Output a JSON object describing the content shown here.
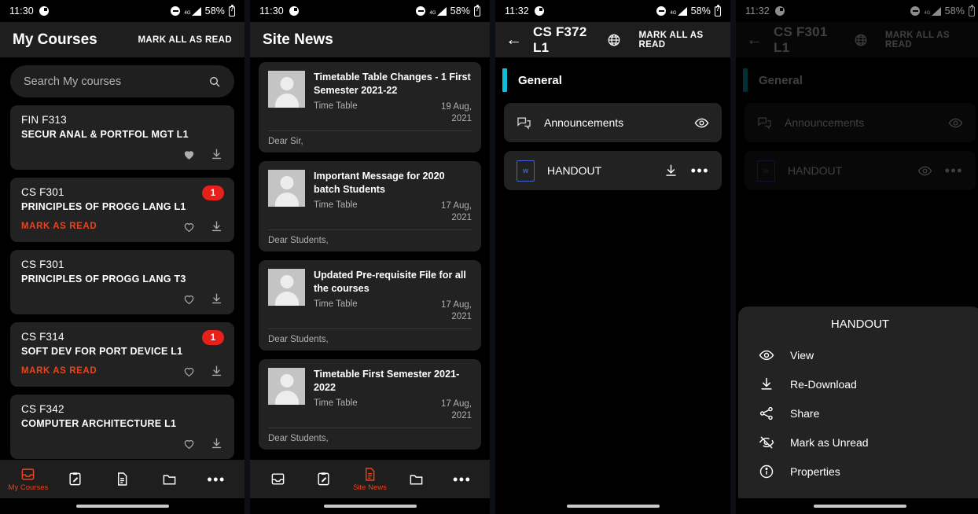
{
  "panels": [
    {
      "status": {
        "time": "11:30",
        "battery": "58%",
        "network": "4G"
      },
      "appbar": {
        "title": "My Courses",
        "action": "MARK ALL AS READ"
      },
      "search": {
        "placeholder": "Search My courses"
      },
      "courses": [
        {
          "code": "FIN F313",
          "name": "SECUR ANAL & PORTFOL MGT L1",
          "badge": "",
          "mark_read": "",
          "favorited": true
        },
        {
          "code": "CS F301",
          "name": "PRINCIPLES OF PROGG LANG L1",
          "badge": "1",
          "mark_read": "MARK AS READ",
          "favorited": false
        },
        {
          "code": "CS F301",
          "name": "PRINCIPLES OF PROGG LANG T3",
          "badge": "",
          "mark_read": "",
          "favorited": false
        },
        {
          "code": "CS F314",
          "name": "SOFT DEV FOR PORT DEVICE L1",
          "badge": "1",
          "mark_read": "MARK AS READ",
          "favorited": false
        },
        {
          "code": "CS F342",
          "name": "COMPUTER ARCHITECTURE L1",
          "badge": "",
          "mark_read": "",
          "favorited": false
        }
      ],
      "nav": {
        "active_index": 0,
        "active_label": "My Courses"
      }
    },
    {
      "status": {
        "time": "11:30",
        "battery": "58%",
        "network": "4G"
      },
      "appbar": {
        "title": "Site News"
      },
      "news": [
        {
          "title": "Timetable Table Changes - 1 First Semester 2021-22",
          "author": "Time Table",
          "date": "19 Aug, 2021",
          "snippet": "Dear Sir,"
        },
        {
          "title": "Important Message for 2020 batch Students",
          "author": "Time Table",
          "date": "17 Aug, 2021",
          "snippet": "Dear Students,"
        },
        {
          "title": "Updated Pre-requisite File for all the courses",
          "author": "Time Table",
          "date": "17 Aug, 2021",
          "snippet": "Dear Students,"
        },
        {
          "title": "Timetable First Semester 2021-2022",
          "author": "Time Table",
          "date": "17 Aug, 2021",
          "snippet": "Dear Students,"
        }
      ],
      "nav": {
        "active_index": 2,
        "active_label": "Site News"
      }
    },
    {
      "status": {
        "time": "11:32",
        "battery": "58%",
        "network": "4G"
      },
      "appbar": {
        "title": "CS F372 L1",
        "action": "MARK ALL AS READ"
      },
      "section": {
        "title": "General",
        "accent": "#0fbcd6"
      },
      "modules": [
        {
          "label": "Announcements",
          "type": "forum"
        },
        {
          "label": "HANDOUT",
          "type": "word",
          "badge_letter": "w"
        }
      ]
    },
    {
      "status": {
        "time": "11:32",
        "battery": "58%",
        "network": "4G"
      },
      "appbar": {
        "title": "CS F301 L1",
        "action": "MARK ALL AS READ"
      },
      "section": {
        "title": "General",
        "accent": "#0fbcd6"
      },
      "modules": [
        {
          "label": "Announcements",
          "type": "forum"
        },
        {
          "label": "HANDOUT",
          "type": "word",
          "badge_letter": "w"
        }
      ],
      "modal": {
        "title": "HANDOUT",
        "items": [
          {
            "label": "View",
            "icon": "eye-icon"
          },
          {
            "label": "Re-Download",
            "icon": "download-icon"
          },
          {
            "label": "Share",
            "icon": "share-icon"
          },
          {
            "label": "Mark as Unread",
            "icon": "eye-off-icon"
          },
          {
            "label": "Properties",
            "icon": "info-icon"
          }
        ]
      }
    }
  ],
  "colors": {
    "accent_orange": "#e8451f",
    "badge_red": "#e8201a",
    "section_cyan": "#0fbcd6",
    "word_blue": "#3a63d8"
  }
}
